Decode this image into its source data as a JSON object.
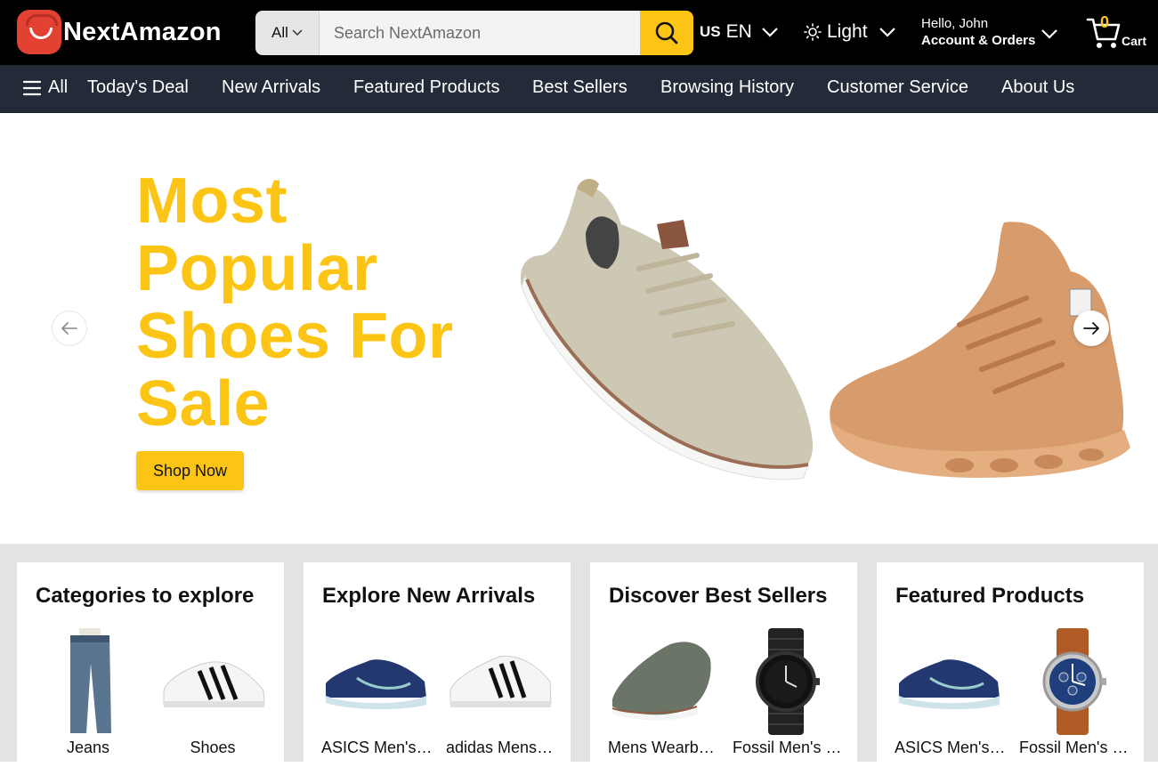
{
  "header": {
    "logo_text": "NextAmazon",
    "search": {
      "category": "All",
      "placeholder": "Search NextAmazon"
    },
    "lang": {
      "flag": "US",
      "label": "EN"
    },
    "theme": {
      "label": "Light"
    },
    "account": {
      "hello": "Hello, John",
      "orders": "Account & Orders"
    },
    "cart": {
      "count": "0",
      "label": "Cart"
    }
  },
  "nav": {
    "all": "All",
    "items": [
      "Today's Deal",
      "New Arrivals",
      "Featured Products",
      "Best Sellers",
      "Browsing History",
      "Customer Service",
      "About Us"
    ]
  },
  "hero": {
    "title": "Most Popular Shoes For Sale",
    "button": "Shop Now"
  },
  "cards": [
    {
      "title": "Categories to explore",
      "tiles": [
        "Jeans",
        "Shoes"
      ]
    },
    {
      "title": "Explore New Arrivals",
      "tiles": [
        "ASICS Men's GEL-Nimbus",
        "adidas Mens Grand Court"
      ]
    },
    {
      "title": "Discover Best Sellers",
      "tiles": [
        "Mens Wearbreeze Shoes",
        "Fossil Men's Machine"
      ]
    },
    {
      "title": "Featured Products",
      "tiles": [
        "ASICS Men's GEL-Nimbus",
        "Fossil Men's Grant"
      ]
    }
  ],
  "colors": {
    "accent": "#fcc515",
    "header_bg": "#000000",
    "nav_bg": "#222b37",
    "cards_bg": "#e3e3e3"
  }
}
